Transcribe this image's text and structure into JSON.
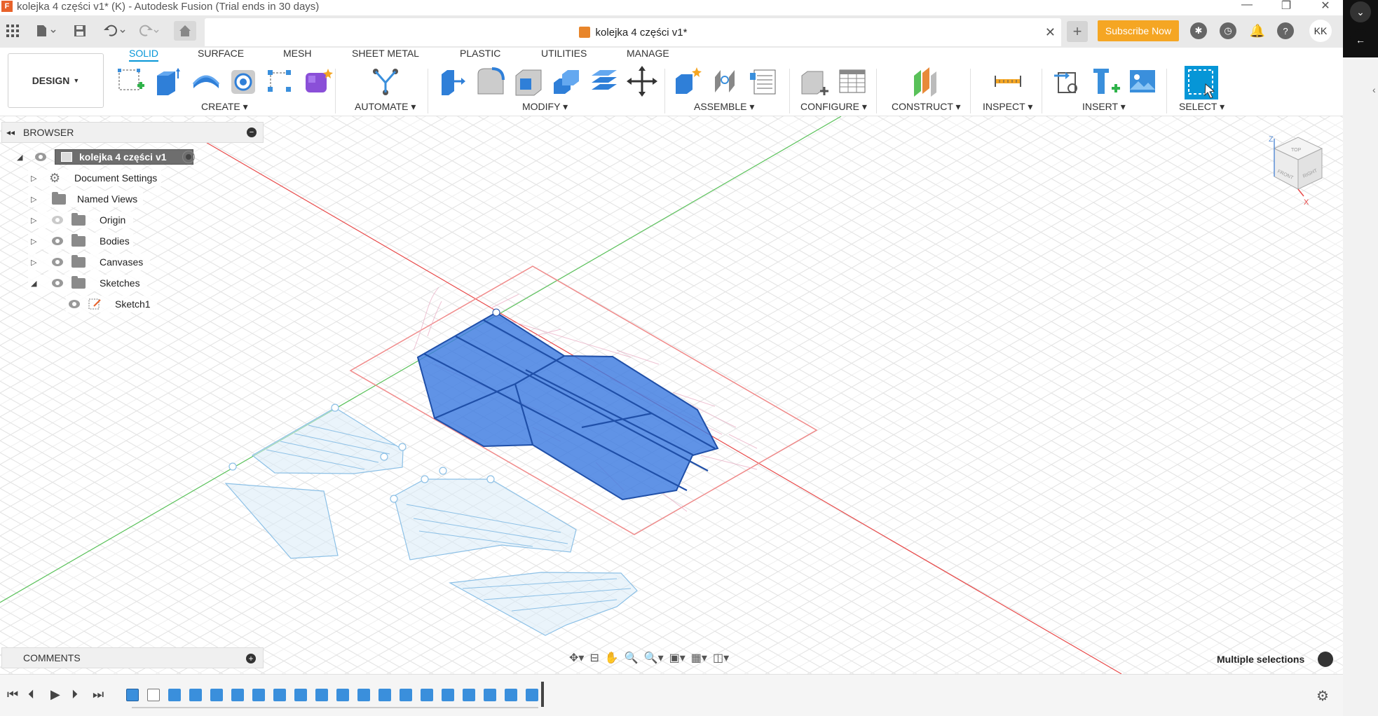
{
  "window": {
    "title": "kolejka 4 części v1* (K) - Autodesk Fusion (Trial ends in 30 days)",
    "app_logo": "F",
    "controls": [
      "—",
      "❐",
      "✕"
    ]
  },
  "tabbar": {
    "doc_title": "kolejka 4 części v1*",
    "subscribe_label": "Subscribe Now",
    "avatar": "KK",
    "icons": [
      "apps-grid-icon",
      "file-icon",
      "save-icon",
      "undo-icon",
      "redo-icon",
      "home-icon",
      "close-icon",
      "add-tab-icon",
      "extensions-icon",
      "job-status-icon",
      "notifications-icon",
      "help-icon"
    ]
  },
  "toolbar": {
    "workspace": "DESIGN",
    "tabs": [
      "SOLID",
      "SURFACE",
      "MESH",
      "SHEET METAL",
      "PLASTIC",
      "UTILITIES",
      "MANAGE"
    ],
    "active_tab": "SOLID",
    "groups": {
      "create": "CREATE",
      "automate": "AUTOMATE",
      "modify": "MODIFY",
      "assemble": "ASSEMBLE",
      "configure": "CONFIGURE",
      "construct": "CONSTRUCT",
      "inspect": "INSPECT",
      "insert": "INSERT",
      "select": "SELECT"
    }
  },
  "browser": {
    "title": "BROWSER",
    "root": "kolejka 4 części v1",
    "items": [
      {
        "label": "Document Settings",
        "icon": "gear-icon"
      },
      {
        "label": "Named Views",
        "icon": "folder-icon"
      },
      {
        "label": "Origin",
        "icon": "folder-icon"
      },
      {
        "label": "Bodies",
        "icon": "folder-icon"
      },
      {
        "label": "Canvases",
        "icon": "folder-icon"
      },
      {
        "label": "Sketches",
        "icon": "folder-icon"
      },
      {
        "label": "Sketch1",
        "icon": "sketch-icon"
      }
    ]
  },
  "comments": {
    "title": "COMMENTS"
  },
  "status": {
    "selection": "Multiple selections"
  },
  "viewcube": {
    "axis_z": "Z",
    "axis_x": "X",
    "face_top": "TOP",
    "face_front": "FRONT",
    "face_right": "RIGHT"
  },
  "colors": {
    "accent": "#0696d7",
    "subscribe": "#f5a623",
    "body_fill": "#3d7be0",
    "body_edge": "#1f4fa8",
    "sketch_ghost": "#b8d7ee",
    "axis_red": "#e84a4a",
    "axis_green": "#59c159"
  },
  "timeline": {
    "feature_count": 20
  }
}
